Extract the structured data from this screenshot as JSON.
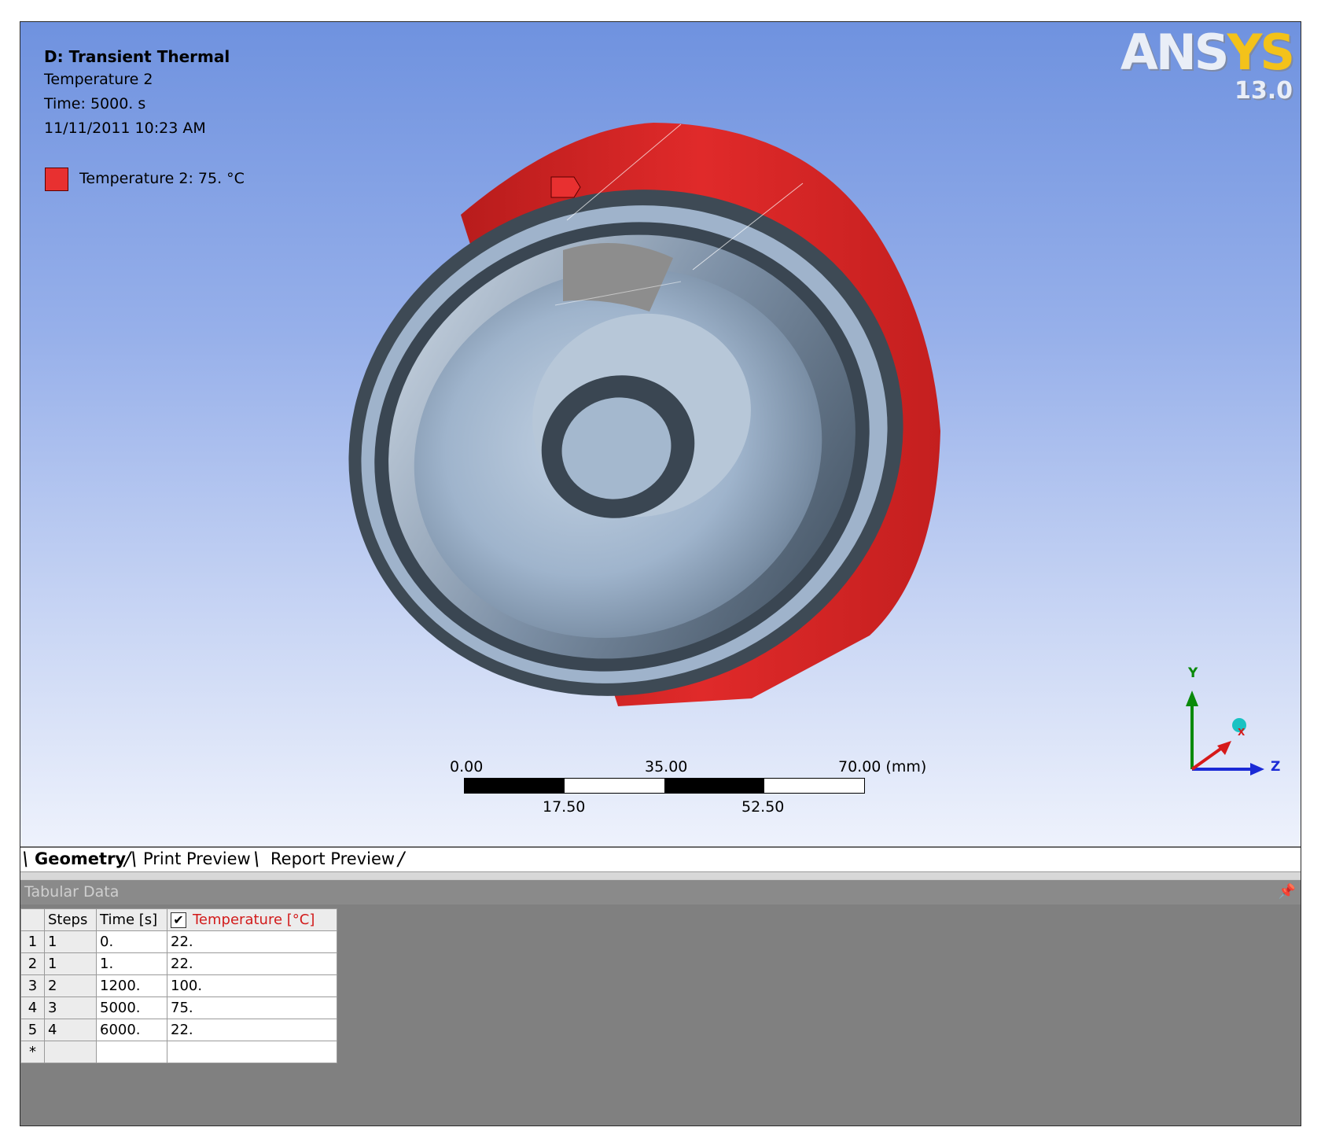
{
  "viewport": {
    "analysis_title": "D: Transient Thermal",
    "result_name": "Temperature 2",
    "time_label": "Time: 5000. s",
    "timestamp": "11/11/2011 10:23 AM",
    "legend_label": "Temperature 2: 75. °C",
    "legend_color": "#e83030",
    "logo_word_a": "ANS",
    "logo_word_b": "YS",
    "logo_version": "13.0",
    "scale_labels_top": [
      "0.00",
      "35.00",
      "70.00 (mm)"
    ],
    "scale_labels_bottom": [
      "17.50",
      "52.50"
    ],
    "triad": {
      "y": "Y",
      "x": "X",
      "z": "Z"
    },
    "colors": {
      "body_red": "#e02a2a",
      "metal_dark": "#3e4a55",
      "metal_light": "#a9bed6",
      "selected_gray": "#8d8d8d"
    }
  },
  "tabs": {
    "geometry": "Geometry",
    "print_preview": "Print Preview",
    "report_preview": "Report Preview"
  },
  "tabular": {
    "title": "Tabular Data",
    "pin_icon": "pin-icon",
    "columns": {
      "steps": "Steps",
      "time": "Time [s]",
      "temperature": "Temperature [°C]"
    },
    "temperature_checked": true,
    "rows": [
      {
        "index": "1",
        "steps": "1",
        "time": "0.",
        "temperature": "22."
      },
      {
        "index": "2",
        "steps": "1",
        "time": "1.",
        "temperature": "22."
      },
      {
        "index": "3",
        "steps": "2",
        "time": "1200.",
        "temperature": "100."
      },
      {
        "index": "4",
        "steps": "3",
        "time": "5000.",
        "temperature": "75."
      },
      {
        "index": "5",
        "steps": "4",
        "time": "6000.",
        "temperature": "22."
      }
    ],
    "new_row_marker": "*"
  }
}
